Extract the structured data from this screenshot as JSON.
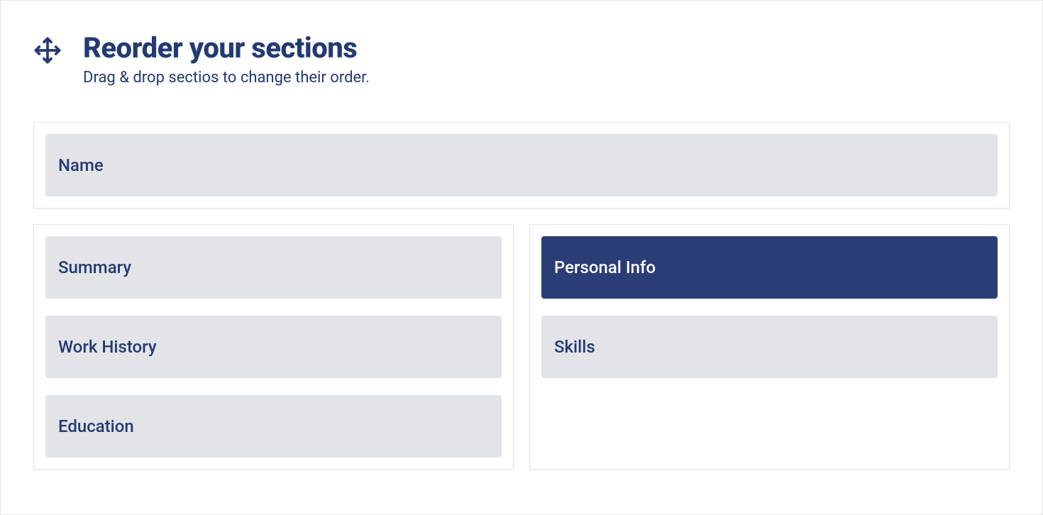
{
  "header": {
    "title": "Reorder your sections",
    "subtitle": "Drag & drop sectios to change their order."
  },
  "top_section": {
    "label": "Name"
  },
  "left_column": {
    "items": [
      {
        "label": "Summary"
      },
      {
        "label": "Work History"
      },
      {
        "label": "Education"
      }
    ]
  },
  "right_column": {
    "items": [
      {
        "label": "Personal Info",
        "active": true
      },
      {
        "label": "Skills",
        "active": false
      }
    ]
  },
  "colors": {
    "brand": "#233a73",
    "brand_dark": "#2a3d76",
    "item_bg": "#e3e4e8"
  }
}
